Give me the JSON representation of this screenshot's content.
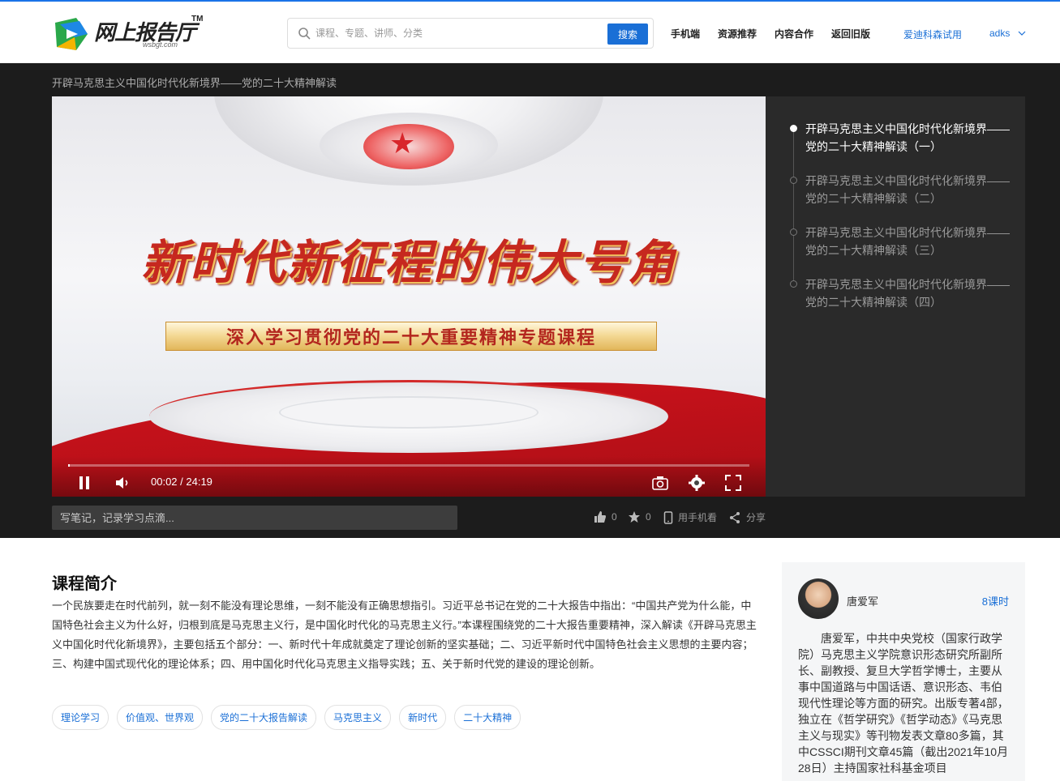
{
  "header": {
    "logo_text": "网上报告厅",
    "logo_tm": "TM",
    "logo_sub": "wsbgt.com",
    "search_placeholder": "课程、专题、讲师、分类",
    "search_button": "搜索",
    "nav": [
      "手机端",
      "资源推荐",
      "内容合作",
      "返回旧版"
    ],
    "trial": "爱迪科森试用",
    "user": "adks"
  },
  "course": {
    "breadcrumb": "开辟马克思主义中国化时代化新境界——党的二十大精神解读",
    "video": {
      "slogan_main": "新时代新征程的伟大号角",
      "slogan_sub": "深入学习贯彻党的二十大重要精神专题课程",
      "current_time": "00:02",
      "duration": "24:19",
      "time_display": "00:02 / 24:19",
      "progress": 0.0014
    },
    "playlist": [
      {
        "title": "开辟马克思主义中国化时代化新境界——党的二十大精神解读（一）",
        "active": true
      },
      {
        "title": "开辟马克思主义中国化时代化新境界——党的二十大精神解读（二）",
        "active": false
      },
      {
        "title": "开辟马克思主义中国化时代化新境界——党的二十大精神解读（三）",
        "active": false
      },
      {
        "title": "开辟马克思主义中国化时代化新境界——党的二十大精神解读（四）",
        "active": false
      }
    ],
    "note_placeholder": "写笔记，记录学习点滴...",
    "actions": {
      "likes": "0",
      "favorites": "0",
      "mobile": "用手机看",
      "share": "分享"
    }
  },
  "intro": {
    "title": "课程简介",
    "text": "一个民族要走在时代前列，就一刻不能没有理论思维，一刻不能没有正确思想指引。习近平总书记在党的二十大报告中指出：“中国共产党为什么能，中国特色社会主义为什么好，归根到底是马克思主义行，是中国化时代化的马克思主义行。”本课程围绕党的二十大报告重要精神，深入解读《开辟马克思主义中国化时代化新境界》，主要包括五个部分：一、新时代十年成就奠定了理论创新的坚实基础；二、习近平新时代中国特色社会主义思想的主要内容；三、构建中国式现代化的理论体系；四、用中国化时代化马克思主义指导实践；五、关于新时代党的建设的理论创新。",
    "tags": [
      "理论学习",
      "价值观、世界观",
      "党的二十大报告解读",
      "马克思主义",
      "新时代",
      "二十大精神"
    ]
  },
  "teacher": {
    "name": "唐爱军",
    "hours": "8课时",
    "bio": "唐爱军，中共中央党校（国家行政学院）马克思主义学院意识形态研究所副所长、副教授、复旦大学哲学博士，主要从事中国道路与中国话语、意识形态、韦伯现代性理论等方面的研究。出版专著4部，独立在《哲学研究》《哲学动态》《马克思主义与现实》等刊物发表文章80多篇，其中CSSCI期刊文章45篇（截出2021年10月28日）主持国家社科基金项目"
  },
  "colors": {
    "accent": "#1a6fd6",
    "dark_bg": "#1c1c1c",
    "playlist_bg": "#2a2a2a"
  }
}
